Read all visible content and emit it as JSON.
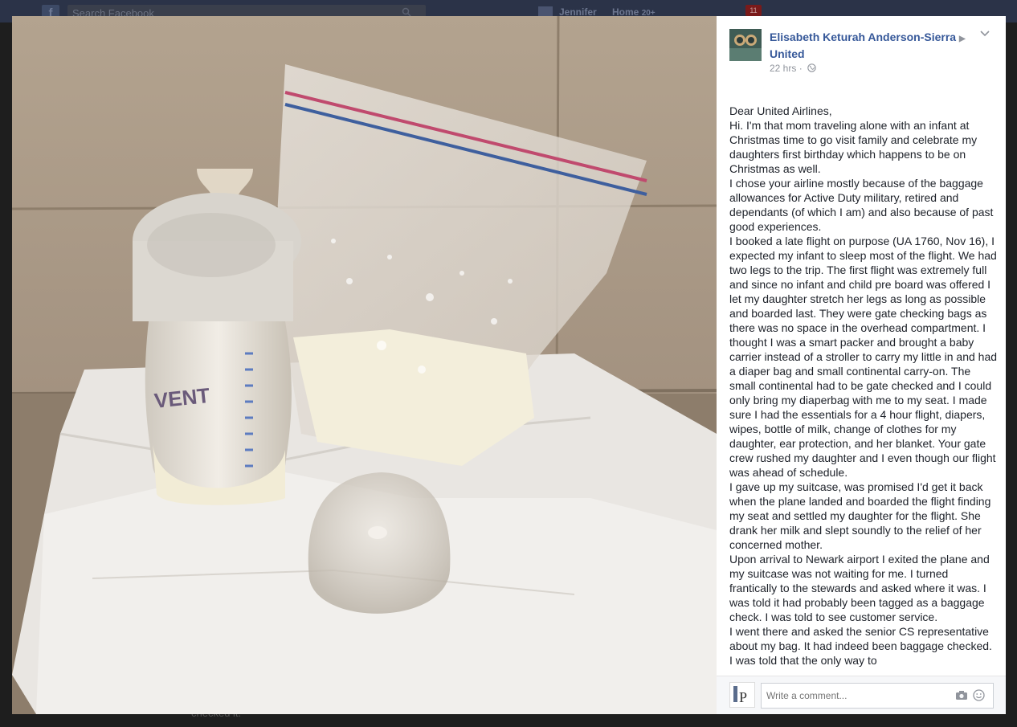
{
  "topbar": {
    "logo": "f",
    "search_placeholder": "Search Facebook",
    "user_name": "Jennifer",
    "home_label": "Home",
    "home_count": "20+",
    "notification_count": "11"
  },
  "background_text": "checked it.",
  "post": {
    "author": "Elisabeth Keturah Anderson-Sierra",
    "recipient": "United",
    "timestamp": "22 hrs",
    "separator": "·",
    "paragraphs": [
      "Dear United Airlines,",
      "Hi. I'm that mom traveling alone with an infant at Christmas time to go visit family and celebrate my daughters first birthday which happens to be on Christmas as well.",
      "I chose your airline mostly because of the baggage allowances for Active Duty military, retired and dependants (of which I am) and also because of past good experiences.",
      "I booked a late flight on purpose (UA 1760, Nov 16), I expected my infant to sleep most of the flight. We had two legs to the trip. The first flight was extremely full and since no infant and child pre board was offered I let my daughter stretch her legs as long as possible and boarded last. They were gate checking bags as there was no space in the overhead compartment. I thought I was a smart packer and brought a baby carrier instead of a stroller to carry my little in and had a diaper bag and small continental carry-on. The small continental had to be gate checked and I could only bring my diaperbag with me to my seat. I made sure I had the essentials for a 4 hour flight, diapers, wipes, bottle of milk, change of clothes for my daughter, ear protection, and her blanket. Your gate crew rushed my daughter and I even though our flight was ahead of schedule.",
      "I gave up my suitcase, was promised I'd get it back when the plane landed and boarded the flight finding my seat and settled my daughter for the flight. She drank her milk and slept soundly to the relief of her concerned mother.",
      "Upon arrival to Newark airport I exited the plane and my suitcase was not waiting for me. I turned frantically to the stewards and asked where it was. I was told it had probably been tagged as a baggage check. I was told to see customer service.",
      "I went there and asked the senior CS representative about my bag. It had indeed been baggage checked. I was told that the only way to"
    ]
  },
  "comment": {
    "placeholder": "Write a comment..."
  },
  "photo": {
    "bottle_brand": "VENT"
  }
}
